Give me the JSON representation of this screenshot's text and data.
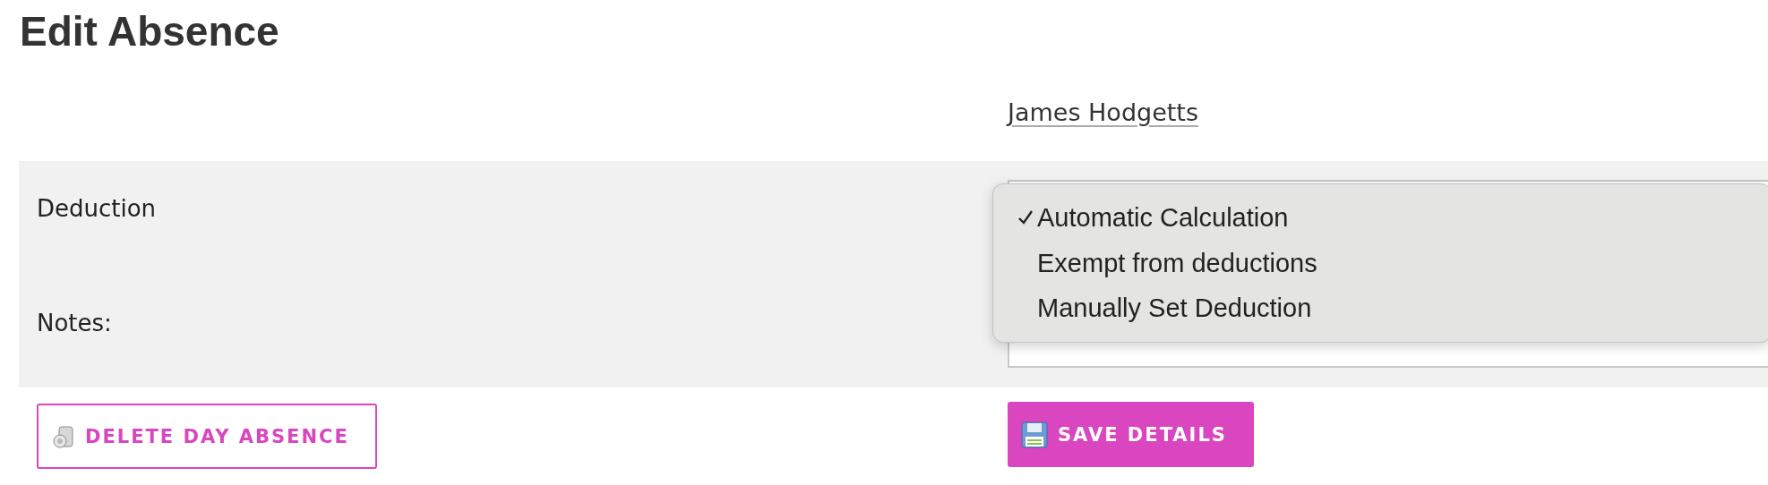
{
  "title": "Edit Absence",
  "employee_link": "James Hodgetts",
  "fields": [
    {
      "label": "Deduction"
    },
    {
      "label": "Notes:"
    }
  ],
  "deduction_menu": {
    "options": [
      {
        "label": "Automatic Calculation",
        "selected": true
      },
      {
        "label": "Exempt from deductions",
        "selected": false
      },
      {
        "label": "Manually Set Deduction",
        "selected": false
      }
    ]
  },
  "buttons": [
    {
      "kind": "delete",
      "label": "DELETE DAY ABSENCE"
    },
    {
      "kind": "save",
      "label": "SAVE DETAILS"
    }
  ]
}
